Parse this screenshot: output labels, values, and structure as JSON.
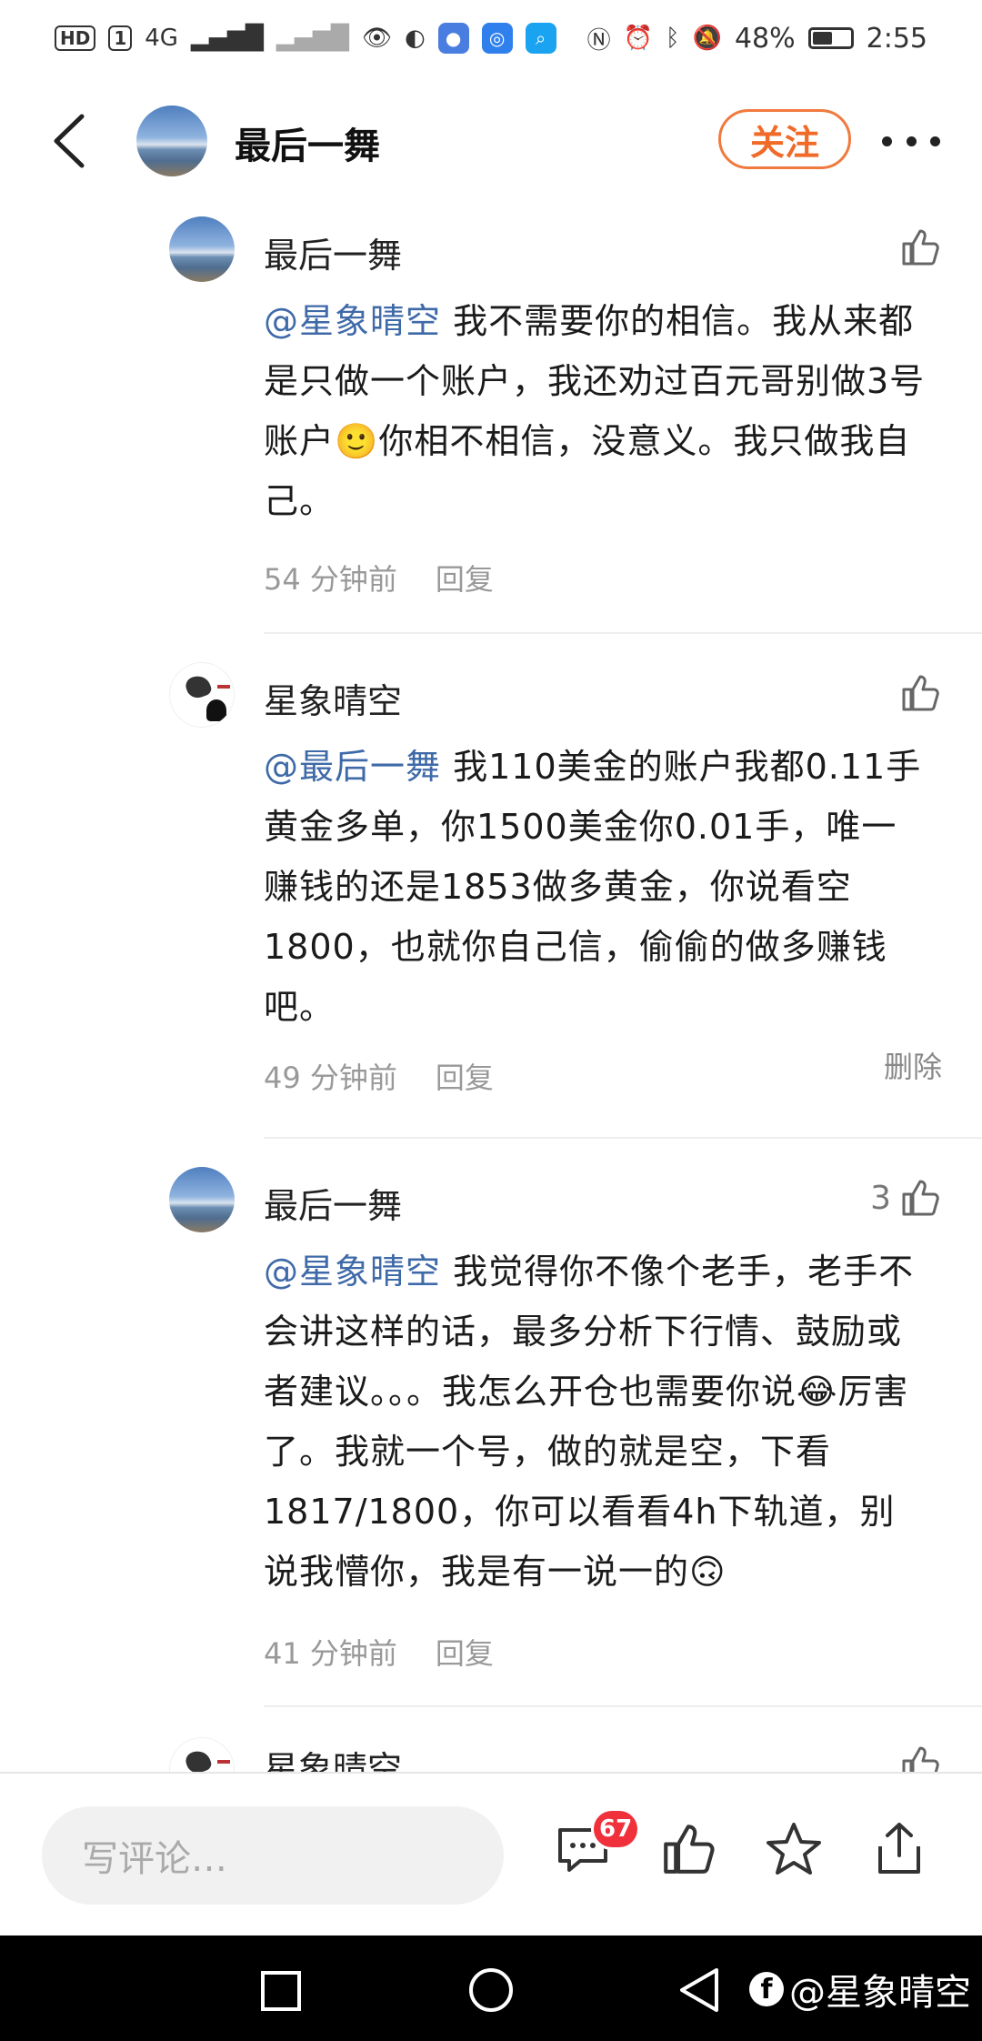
{
  "status_bar": {
    "left_badges": [
      "HD",
      "1"
    ],
    "network": "4G",
    "battery": "48%",
    "time": "2:55"
  },
  "header": {
    "title": "最后一舞",
    "follow_label": "关注"
  },
  "comments": [
    {
      "author": "最后一舞",
      "mention": "@星象晴空",
      "text": " 我不需要你的相信。我从来都是只做一个账户，我还劝过百元哥别做3号账户🙂你相不相信，没意义。我只做我自己。",
      "time": "54 分钟前",
      "reply_label": "回复",
      "likes": "",
      "avatar": "sky"
    },
    {
      "author": "星象晴空",
      "mention": "@最后一舞",
      "text": " 我110美金的账户我都0.11手黄金多单，你1500美金你0.01手，唯一赚钱的还是1853做多黄金，你说看空1800，也就你自己信，偷偷的做多赚钱吧。",
      "time": "49 分钟前",
      "reply_label": "回复",
      "delete_label": "删除",
      "likes": "",
      "avatar": "ink"
    },
    {
      "author": "最后一舞",
      "mention": "@星象晴空",
      "text": " 我觉得你不像个老手，老手不会讲这样的话，最多分析下行情、鼓励或者建议。。。我怎么开仓也需要你说😂厉害了。我就一个号，做的就是空，下看1817/1800，你可以看看4h下轨道，别说我懵你，我是有一说一的🙃",
      "time": "41 分钟前",
      "reply_label": "回复",
      "likes": "3",
      "avatar": "sky"
    },
    {
      "author": "星象晴空",
      "avatar": "ink"
    }
  ],
  "bottom_bar": {
    "input_placeholder": "写评论…",
    "comment_count": "67"
  },
  "watermark": "@星象晴空"
}
